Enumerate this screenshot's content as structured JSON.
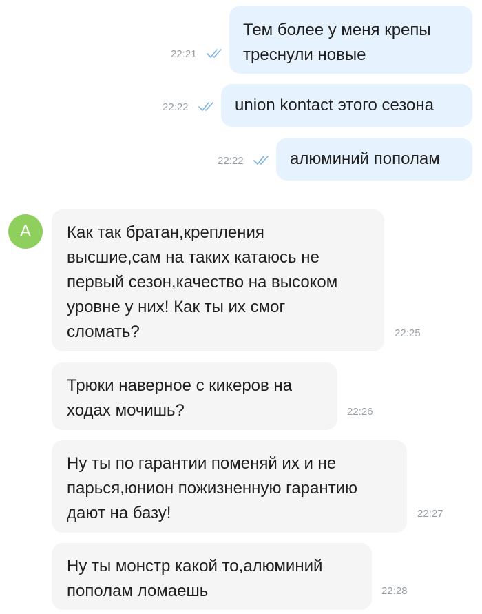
{
  "contact": {
    "avatar_initial": "A"
  },
  "outgoing": [
    {
      "lines": [
        "Тем более у меня крепы",
        "треснули  новые"
      ],
      "time": "22:21"
    },
    {
      "lines": [
        "union kontact этого сезона"
      ],
      "time": "22:22"
    },
    {
      "lines": [
        "алюминий пополам"
      ],
      "time": "22:22"
    }
  ],
  "incoming": [
    {
      "lines": [
        "Как так братан,крепления",
        "высшие,сам на таких катаюсь не",
        "первый сезон,качество на высоком",
        "уровне у них! Как ты их смог",
        "сломать?"
      ],
      "time": "22:25"
    },
    {
      "lines": [
        "Трюки наверное с кикеров на",
        "ходах мочишь?"
      ],
      "time": "22:26"
    },
    {
      "lines": [
        "Ну ты по гарантии поменяй их и не",
        "парься,юнион пожизненную гарантию",
        "дают на базу!"
      ],
      "time": "22:27"
    },
    {
      "lines": [
        "Ну ты монстр какой то,алюминий",
        "пополам ломаешь"
      ],
      "time": "22:28"
    }
  ],
  "colors": {
    "outgoing_bubble": "#e6f2fd",
    "incoming_bubble": "#f5f5f5",
    "read_checks": "#7fb3e0",
    "avatar": "#8fcf5e",
    "timestamp": "#9aa0a6"
  },
  "icons": {
    "read_status": "double-check-icon"
  }
}
